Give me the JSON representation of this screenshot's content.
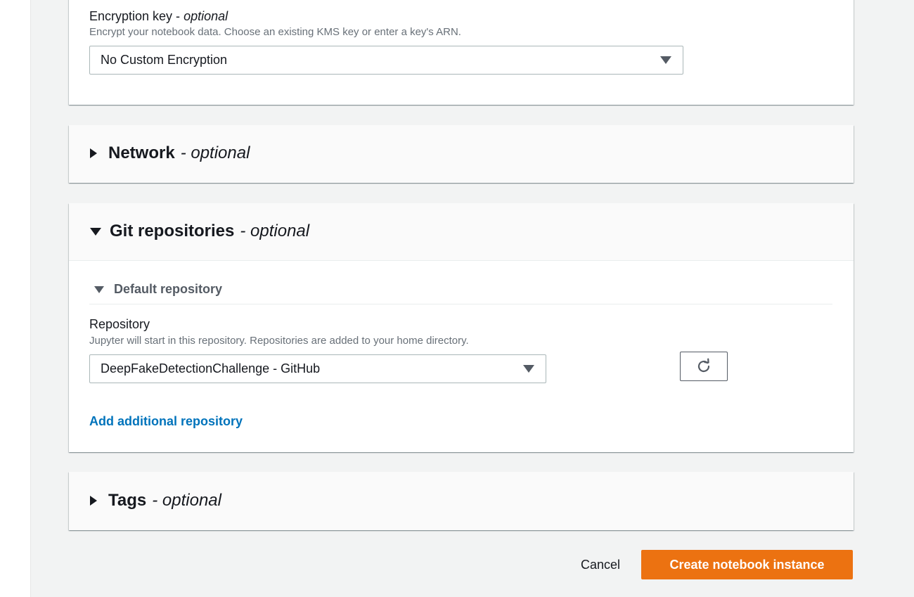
{
  "encryption": {
    "label": "Encryption key - ",
    "optional": "optional",
    "description": "Encrypt your notebook data. Choose an existing KMS key or enter a key's ARN.",
    "selected": "No Custom Encryption"
  },
  "network": {
    "title": "Network",
    "optional": "- optional"
  },
  "git": {
    "title": "Git repositories",
    "optional": "- optional",
    "default_repository": {
      "title": "Default repository",
      "label": "Repository",
      "description": "Jupyter will start in this repository. Repositories are added to your home directory.",
      "selected": "DeepFakeDetectionChallenge - GitHub"
    },
    "add_link": "Add additional repository"
  },
  "tags": {
    "title": "Tags",
    "optional": "- optional"
  },
  "footer": {
    "cancel_label": "Cancel",
    "create_label": "Create notebook instance"
  },
  "icons": {
    "refresh": "refresh-icon",
    "caret": "caret-down-icon",
    "expand": "caret-right-icon",
    "collapse": "caret-down-icon"
  },
  "colors": {
    "primary_button": "#ec7211",
    "link": "#0073bb",
    "background": "#f2f3f3"
  }
}
